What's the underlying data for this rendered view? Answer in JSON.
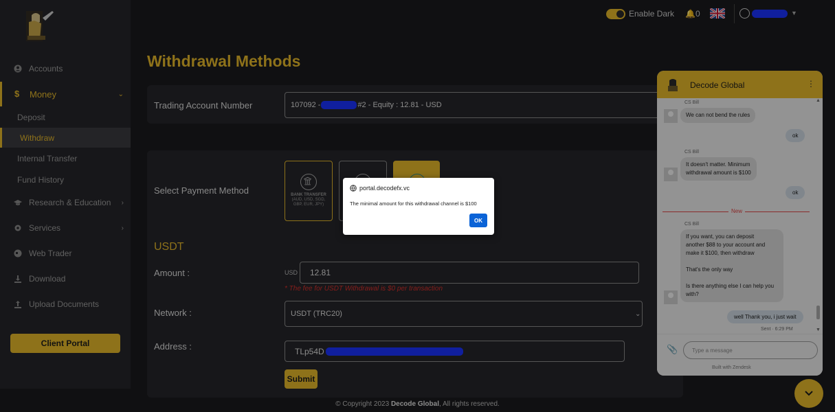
{
  "sidebar": {
    "items": [
      {
        "label": "Accounts"
      },
      {
        "label": "Money"
      },
      {
        "label": "Research & Education"
      },
      {
        "label": "Services"
      },
      {
        "label": "Web Trader"
      },
      {
        "label": "Download"
      },
      {
        "label": "Upload Documents"
      }
    ],
    "money_sub": [
      "Deposit",
      "Withdraw",
      "Internal Transfer",
      "Fund History"
    ],
    "client_portal_label": "Client Portal"
  },
  "topbar": {
    "dark_mode_label": "Enable Dark",
    "notification_count": "0"
  },
  "main": {
    "title": "Withdrawal Methods",
    "trading_account_label": "Trading Account Number",
    "trading_account_value_prefix": "107092 - ",
    "trading_account_value_suffix": "#2 - Equity : 12.81 - USD",
    "payment_method_label": "Select Payment Method",
    "bank_transfer_label": "BANK TRANSFER",
    "bank_transfer_currencies": "(AUD, USD, SGD, GBP, EUR, JPY)",
    "usdt_title": "USDT",
    "amount_label": "Amount :",
    "amount_currency": "USD",
    "amount_value": "12.81",
    "fee_note": "* The fee for USDT Withdrawal is $0 per transaction",
    "network_label": "Network :",
    "network_value": "USDT (TRC20)",
    "address_label": "Address :",
    "address_prefix": "TLp54D",
    "submit_label": "Submit"
  },
  "footer": {
    "prefix": "© Copyright 2023 ",
    "brand": "Decode Global",
    "suffix": ", All rights reserved."
  },
  "alert": {
    "origin": "portal.decodefx.vc",
    "message": "The minimal amount for this withdrawal channel is $100",
    "ok_label": "OK"
  },
  "chat": {
    "title": "Decode Global",
    "new_label": "New",
    "messages": [
      {
        "author": "CS Bill",
        "text": "We can not bend the rules"
      },
      {
        "own": "ok"
      },
      {
        "author": "CS Bill",
        "text1": "It doesn't matter. Minimum",
        "text2": "withdrawal amount is $100"
      },
      {
        "own": "ok"
      },
      {
        "author": "CS Bill",
        "lines": [
          "If you want, you can deposit",
          "another $88 to your account and",
          "make it $100, then withdraw",
          "",
          "That's the only way",
          "",
          "Is there anything else I can help you",
          "with?"
        ]
      },
      {
        "own": "well Thank you, i just wait"
      }
    ],
    "sent_label": "Sent · 6:29 PM",
    "input_placeholder": "Type a message",
    "built_with": "Built with Zendesk"
  },
  "colors": {
    "accent": "#e5b82a",
    "background": "#1b1b1d",
    "panel": "#26262a",
    "error": "#d9302b",
    "dialog_button": "#0b63d7"
  }
}
